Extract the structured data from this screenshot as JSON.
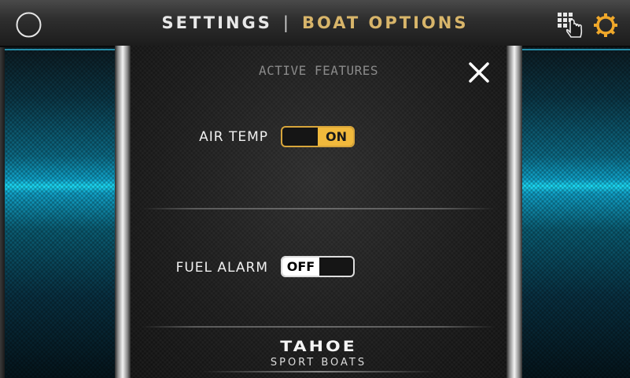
{
  "header": {
    "title_left": "SETTINGS",
    "title_separator": "|",
    "title_right": "BOAT OPTIONS",
    "icons": {
      "night_mode": "moon-icon",
      "touch_grid": "touch-grid-icon",
      "settings": "gear-icon"
    }
  },
  "panel": {
    "title": "ACTIVE FEATURES",
    "close_icon": "close-icon",
    "features": [
      {
        "label": "AIR  TEMP",
        "state": "ON"
      },
      {
        "label": "FUEL ALARM",
        "state": "OFF"
      }
    ]
  },
  "brand": {
    "name": "TAHOE",
    "tagline": "SPORT BOATS"
  },
  "colors": {
    "accent_gold": "#d8b56a",
    "toggle_on": "#f1b93c",
    "side_glow": "#1de3ff"
  }
}
